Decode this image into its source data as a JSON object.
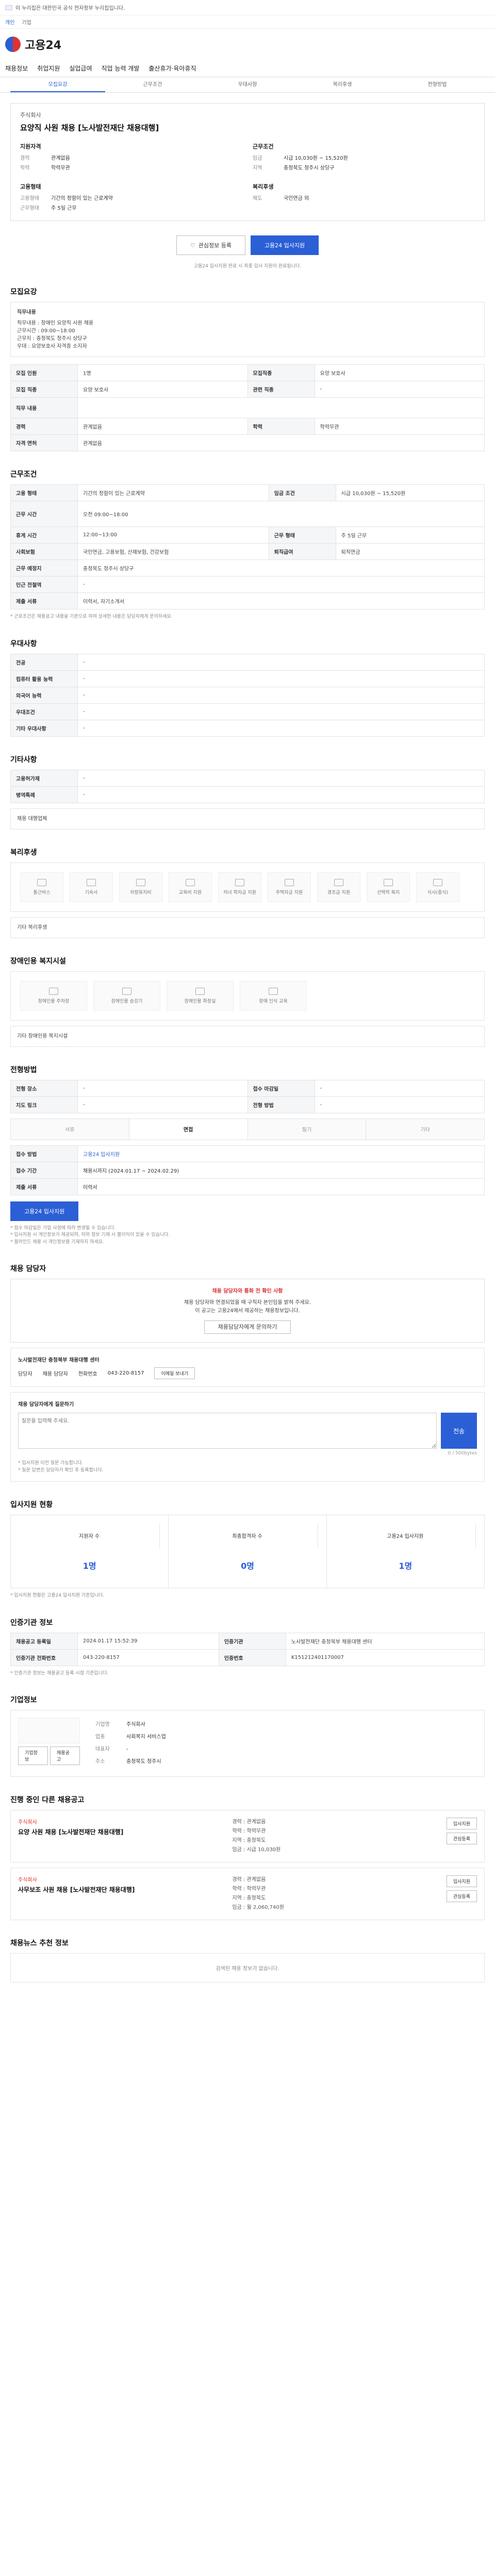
{
  "gov_banner": "이 누리집은 대한민국 공식 전자정부 누리집입니다.",
  "top_links": [
    "개인",
    "기업"
  ],
  "logo_text": "고용24",
  "gnb": [
    "채용정보",
    "취업지원",
    "실업급여",
    "직업 능력 개발",
    "출산휴가·육아휴직"
  ],
  "subtabs": [
    "모집요강",
    "근무조건",
    "우대사항",
    "복리후생",
    "전형방법"
  ],
  "head": {
    "company": "주식회사",
    "title": "요양직 사원 채용 [노사발전재단 채용대행]",
    "left_h": "지원자격",
    "left": [
      [
        "경력",
        "관계없음"
      ],
      [
        "학력",
        "학력무관"
      ]
    ],
    "right_h": "근무조건",
    "right": [
      [
        "임금",
        "시급 10,030원 ~ 15,520원"
      ],
      [
        "지역",
        "충청북도 청주시 상당구"
      ]
    ],
    "left_h2": "고용형태",
    "left2": [
      [
        "고용형태",
        "기간의 정함이 있는 근로계약"
      ],
      [
        "근무형태",
        "주 5일 근무"
      ]
    ],
    "right_h2": "복리후생",
    "right2": [
      [
        "제도",
        "국민연금 외"
      ]
    ]
  },
  "buttons": {
    "bookmark": "관심정보 등록",
    "apply": "고용24 입사지원"
  },
  "apply_note": "고용24 입사지원 완료 시 최종 입사 지원이 완료됩니다.",
  "sections": {
    "recruit": "모집요강",
    "conditions": "근무조건",
    "preference": "우대사항",
    "other": "기타사항",
    "welfare": "복리후생",
    "disability": "장애인용 복지시설",
    "method": "전형방법",
    "contact": "채용 담당자",
    "stats": "입사지원 현황",
    "company_info": "인증기관 정보",
    "biz": "기업정보",
    "similar": "진행 중인 다른 채용공고",
    "recent": "채용뉴스 추천 정보"
  },
  "job_desc_label": "직무내용",
  "job_desc": "직무내용 : 장애인 요양직 사원 채용\n근무시간 : 09:00~18:00\n근무지 : 충청북도 청주시 상당구\n우대 : 요양보호사 자격증 소지자",
  "recruit_rows": [
    [
      "모집 인원",
      "1명",
      "모집직종",
      "요양 보호사"
    ],
    [
      "모집 직종",
      "요양 보호사",
      "관련 직종",
      "-"
    ],
    [
      "직무 내용",
      "",
      "",
      ""
    ],
    [
      "경력",
      "관계없음",
      "학력",
      "학력무관"
    ],
    [
      "자격 면허",
      "관계없음",
      "",
      ""
    ]
  ],
  "cond_rows": [
    [
      "고용 형태",
      "기간의 정함이 있는 근로계약",
      "임금 조건",
      "시급 10,030원 ~ 15,520원"
    ],
    [
      "근무 시간",
      "오전 09:00~18:00",
      "",
      ""
    ],
    [
      "휴게 시간",
      "12:00~13:00",
      "근무 형태",
      "주 5일 근무"
    ],
    [
      "사회보험",
      "국민연금, 고용보험, 산재보험, 건강보험",
      "퇴직급여",
      "퇴직연금"
    ],
    [
      "근무 예정지",
      "충청북도 청주시 상당구",
      "",
      ""
    ],
    [
      "인근 전철역",
      "-",
      "",
      ""
    ],
    [
      "제출 서류",
      "이력서, 자기소개서",
      "",
      ""
    ]
  ],
  "cond_note": "* 근로조건은 채용공고 내용을 기준으로 하며 상세한 내용은 담당자에게 문의하세요.",
  "pref_rows": [
    [
      "전공",
      "-"
    ],
    [
      "컴퓨터 활용 능력",
      "-"
    ],
    [
      "외국어 능력",
      "-"
    ],
    [
      "우대조건",
      "-"
    ],
    [
      "기타 우대사항",
      "-"
    ]
  ],
  "other_rows": [
    [
      "고용허가제",
      "-"
    ],
    [
      "병역특례",
      "-"
    ]
  ],
  "other_tag": "채용 대행업체",
  "welfare_items": [
    "통근버스",
    "기숙사",
    "차량유지비",
    "교육비 지원",
    "자녀 학자금 지원",
    "주택자금 지원",
    "경조금 지원",
    "선택적 복지",
    "식사(중식)"
  ],
  "welfare_other": "기타 복리후생",
  "disability_items": [
    "장애인용 주차장",
    "장애인용 승강기",
    "장애인용 화장실",
    "장애 인식 교육"
  ],
  "disability_other": "기타 장애인용 복지시설",
  "method_rows": [
    [
      "전형 장소",
      "-"
    ],
    [
      "지도 링크",
      "-"
    ]
  ],
  "method_rows2": [
    [
      "접수 마감일",
      "-"
    ],
    [
      "전형 방법",
      "-"
    ]
  ],
  "steps": [
    "서류",
    "면접",
    "필기",
    "기타"
  ],
  "method_sub": [
    [
      "접수 방법",
      "고용24 입사지원"
    ],
    [
      "접수 기간",
      "채용시까지 (2024.01.17 ~ 2024.02.29)"
    ],
    [
      "제출 서류",
      "이력서"
    ]
  ],
  "method_notes": "* 접수 마감일은 기업 사정에 따라 변경될 수 있습니다.\n* 입사지원 시 개인정보가 제공되며, 허위 정보 기재 시 불이익이 있을 수 있습니다.\n* 블라인드 채용 시 개인정보를 기재하지 마세요.",
  "contact_alert_title": "채용 담당자와 통화 전 확인 사항",
  "contact_alert_body": "채용 담당자와 연결되었을 때 구직자 본인임을 밝혀 주세요.\n이 공고는 고용24에서 제공하는 채용정보입니다.",
  "contact_btn": "채용담당자에게 문의하기",
  "contact_company": "노사발전재단 충청북부 채용대행 센터",
  "contact_rows": [
    [
      "담당자",
      "채용 담당자"
    ],
    [
      "전화번호",
      "043-220-8157"
    ]
  ],
  "contact_btn2": "이메일 보내기",
  "inquiry_label": "채용 담당자에게 질문하기",
  "inquiry_placeholder": "질문을 입력해 주세요.",
  "inquiry_send": "전송",
  "inquiry_count": "0 / 500bytes",
  "inquiry_notes": "* 입사지원 이전 질문 가능합니다.\n* 질문 답변은 담당자가 확인 후 등록합니다.",
  "stats_items": [
    [
      "지원자 수",
      "1명"
    ],
    [
      "최종합격자 수",
      "0명"
    ],
    [
      "고용24 입사지원",
      "1명"
    ]
  ],
  "stats_note": "* 입사지원 현황은 고용24 입사지원 기준입니다.",
  "cert_rows": [
    [
      "채용공고 등록일",
      "2024.01.17 15:52:39",
      "인증기관",
      "노사발전재단 충청북부 채용대행 센터"
    ],
    [
      "인증기관 전화번호",
      "043-220-8157",
      "인증번호",
      "K151212401170007"
    ]
  ],
  "cert_notes": "* 인증기관 정보는 채용공고 등록 시점 기준입니다.",
  "biz_rows": [
    [
      "기업명",
      "주식회사"
    ],
    [
      "업종",
      "사회복지 서비스업"
    ],
    [
      "대표자",
      "-"
    ],
    [
      "주소",
      "충청북도 청주시"
    ]
  ],
  "biz_btns": [
    "기업정보",
    "채용공고"
  ],
  "jobs": [
    {
      "company": "주식회사",
      "title": "요양 사원 채용 [노사발전재단 채용대행]",
      "info": "경력 : 관계없음\n학력 : 학력무관\n지역 : 충청북도\n임금 : 시급 10,030원",
      "btn1": "입사지원",
      "btn2": "관심등록"
    },
    {
      "company": "주식회사",
      "title": "사무보조 사원 채용 [노사발전재단 채용대행]",
      "info": "경력 : 관계없음\n학력 : 학력무관\n지역 : 충청북도\n임금 : 월 2,060,740원",
      "btn1": "입사지원",
      "btn2": "관심등록"
    }
  ],
  "empty_note": "검색된 채용 정보가 없습니다."
}
